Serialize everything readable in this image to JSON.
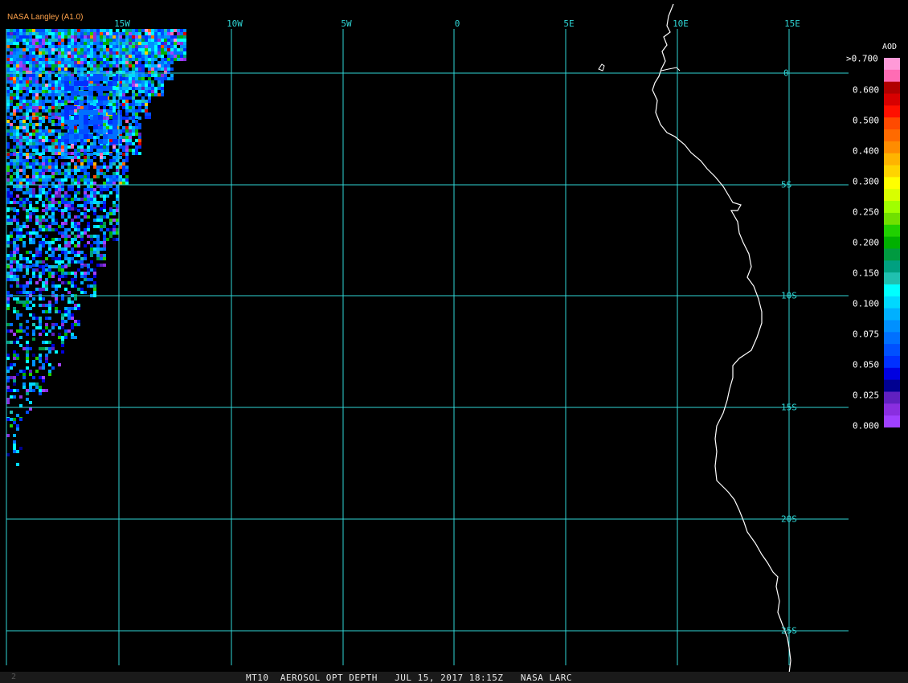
{
  "header": {
    "producer_label": "NASA Langley (A1.0)"
  },
  "grid": {
    "longitude_labels": [
      "15W",
      "10W",
      "5W",
      "0",
      "5E",
      "10E",
      "15E"
    ],
    "latitude_labels": [
      "0",
      "5S",
      "10S",
      "15S",
      "20S",
      "25S"
    ],
    "line_color": "#2fd6d6"
  },
  "legend": {
    "title": "AOD",
    "labels": [
      ">0.700",
      "0.600",
      "0.500",
      "0.400",
      "0.300",
      "0.250",
      "0.200",
      "0.150",
      "0.100",
      "0.075",
      "0.050",
      "0.025",
      "0.000"
    ],
    "colors": [
      "#ff9ad8",
      "#ff6cb4",
      "#b00000",
      "#d80000",
      "#ff1000",
      "#ff4a00",
      "#ff6a00",
      "#ff8c00",
      "#ffb400",
      "#ffd400",
      "#ffff00",
      "#d8ff00",
      "#a0ff00",
      "#70e000",
      "#20d000",
      "#00b000",
      "#009a40",
      "#00a080",
      "#20c0b0",
      "#00ffff",
      "#00d8ff",
      "#00b0ff",
      "#0090ff",
      "#0070ff",
      "#0050ff",
      "#0030ff",
      "#0000e0",
      "#000090",
      "#6020c0",
      "#8a2ee0",
      "#a040ff"
    ]
  },
  "footer": {
    "caption": "MT10  AEROSOL OPT DEPTH   JUL 15, 2017 18:15Z   NASA LARC",
    "frame_number": "2"
  },
  "coastline_color": "#ffffff"
}
